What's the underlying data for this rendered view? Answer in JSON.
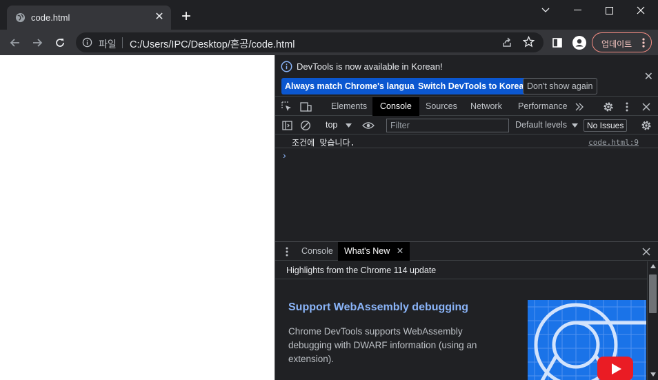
{
  "browser": {
    "tab_title": "code.html",
    "scheme_label": "파일",
    "url": "C:/Users/IPC/Desktop/혼공/code.html",
    "update_button": "업데이트"
  },
  "devtools": {
    "infobar": {
      "message": "DevTools is now available in Korean!",
      "btn_match": "Always match Chrome's language",
      "btn_switch": "Switch DevTools to Korean",
      "btn_dont_show": "Don't show again"
    },
    "tabs": [
      "Elements",
      "Console",
      "Sources",
      "Network",
      "Performance"
    ],
    "active_tab": "Console",
    "console": {
      "context": "top",
      "filter_placeholder": "Filter",
      "levels": "Default levels",
      "issues": "No Issues",
      "log_message": "조건에 맞습니다.",
      "log_source": "code.html:9"
    },
    "drawer": {
      "tabs": [
        "Console",
        "What's New"
      ],
      "active_tab": "What's New",
      "highlights": "Highlights from the Chrome 114 update",
      "heading": "Support WebAssembly debugging",
      "body": "Chrome DevTools supports WebAssembly debugging with DWARF information (using an extension)."
    }
  },
  "colors": {
    "accent_blue": "#0b57d0",
    "link_blue": "#8ab4f8",
    "update_border": "#f28b82"
  }
}
